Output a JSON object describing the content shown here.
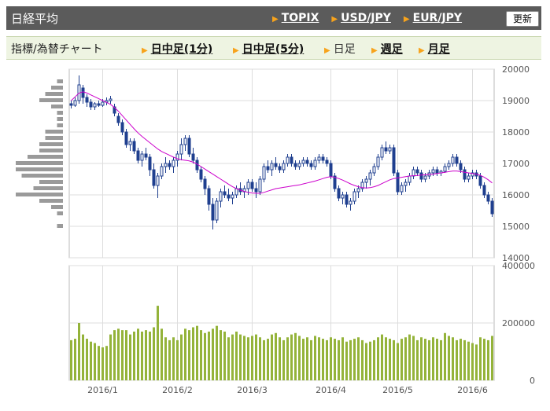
{
  "header": {
    "title": "日経平均",
    "links": [
      "TOPIX",
      "USD/JPY",
      "EUR/JPY"
    ],
    "update_label": "更新"
  },
  "subbar": {
    "label": "指標/為替チャート",
    "tabs": [
      {
        "label": "日中足(1分)",
        "active": false
      },
      {
        "label": "日中足(5分)",
        "active": false
      },
      {
        "label": "日足",
        "active": true
      },
      {
        "label": "週足",
        "active": false
      },
      {
        "label": "月足",
        "active": false
      }
    ]
  },
  "colors": {
    "candle": "#1f3f8f",
    "moving_average": "#cc00cc",
    "volume": "#94b33a",
    "histogram": "#9a9a9a",
    "grid": "#dddddd",
    "header_bg": "#5b5b5b",
    "accent_triangle": "#f7a31c"
  },
  "chart_data": [
    {
      "type": "candlestick",
      "title": "",
      "ylim": [
        14000,
        20000
      ],
      "y_ticks": [
        20000,
        19000,
        18000,
        17000,
        16000,
        15000,
        14000
      ],
      "x_ticks": [
        "2016/1",
        "2016/2",
        "2016/3",
        "2016/4",
        "2016/5",
        "2016/6"
      ],
      "grid": true,
      "series": [
        {
          "kind": "candles",
          "ohlc": [
            [
              18900,
              19000,
              18750,
              18850
            ],
            [
              18850,
              19100,
              18800,
              19000
            ],
            [
              19000,
              19800,
              18900,
              19500
            ],
            [
              19400,
              19500,
              18900,
              19100
            ],
            [
              19100,
              19200,
              18800,
              18950
            ],
            [
              18950,
              19050,
              18700,
              18800
            ],
            [
              18800,
              18950,
              18700,
              18900
            ],
            [
              18900,
              19000,
              18800,
              18850
            ],
            [
              18850,
              19050,
              18800,
              18950
            ],
            [
              18950,
              19100,
              18850,
              19000
            ],
            [
              19000,
              19150,
              18900,
              19050
            ],
            [
              18800,
              18900,
              18500,
              18600
            ],
            [
              18500,
              18600,
              18200,
              18300
            ],
            [
              18300,
              18400,
              17900,
              18000
            ],
            [
              18000,
              18100,
              17500,
              17600
            ],
            [
              17600,
              17800,
              17400,
              17700
            ],
            [
              17700,
              17800,
              17300,
              17400
            ],
            [
              17400,
              17500,
              17000,
              17100
            ],
            [
              17100,
              17400,
              16900,
              17300
            ],
            [
              17300,
              17500,
              17100,
              17200
            ],
            [
              17200,
              17300,
              16600,
              16800
            ],
            [
              16800,
              17000,
              16200,
              16300
            ],
            [
              16300,
              16700,
              15900,
              16600
            ],
            [
              16600,
              17000,
              16500,
              16900
            ],
            [
              16900,
              17200,
              16700,
              17000
            ],
            [
              17000,
              17100,
              16800,
              16900
            ],
            [
              16900,
              17200,
              16700,
              17100
            ],
            [
              17100,
              17400,
              16900,
              17300
            ],
            [
              17300,
              17800,
              17100,
              17600
            ],
            [
              17600,
              17900,
              17400,
              17800
            ],
            [
              17800,
              17900,
              17200,
              17300
            ],
            [
              17300,
              17500,
              17000,
              17100
            ],
            [
              17100,
              17200,
              16700,
              16800
            ],
            [
              16800,
              16900,
              16400,
              16500
            ],
            [
              16500,
              16600,
              16000,
              16200
            ],
            [
              16200,
              16300,
              15500,
              15700
            ],
            [
              15700,
              15900,
              14900,
              15200
            ],
            [
              15200,
              15900,
              15100,
              15800
            ],
            [
              15800,
              16200,
              15600,
              16100
            ],
            [
              16100,
              16300,
              15900,
              16000
            ],
            [
              16000,
              16200,
              15800,
              15900
            ],
            [
              15900,
              16100,
              15700,
              16000
            ],
            [
              16000,
              16300,
              15900,
              16200
            ],
            [
              16200,
              16400,
              16000,
              16100
            ],
            [
              16100,
              16300,
              15900,
              16200
            ],
            [
              16200,
              16500,
              16000,
              16400
            ],
            [
              16400,
              16500,
              16100,
              16200
            ],
            [
              16200,
              16400,
              15900,
              16100
            ],
            [
              16100,
              16600,
              16000,
              16500
            ],
            [
              16500,
              17000,
              16400,
              16900
            ],
            [
              16900,
              17100,
              16700,
              16800
            ],
            [
              16800,
              17100,
              16600,
              17000
            ],
            [
              17000,
              17200,
              16800,
              16900
            ],
            [
              16900,
              17000,
              16700,
              16800
            ],
            [
              16800,
              17100,
              16700,
              17000
            ],
            [
              17000,
              17300,
              16900,
              17200
            ],
            [
              17200,
              17300,
              16900,
              17000
            ],
            [
              17000,
              17100,
              16800,
              16900
            ],
            [
              16900,
              17100,
              16800,
              17000
            ],
            [
              17000,
              17200,
              16900,
              17100
            ],
            [
              17100,
              17200,
              16900,
              17000
            ],
            [
              17000,
              17100,
              16800,
              16900
            ],
            [
              16900,
              17200,
              16800,
              17100
            ],
            [
              17100,
              17300,
              17000,
              17200
            ],
            [
              17200,
              17300,
              17000,
              17100
            ],
            [
              17100,
              17200,
              16900,
              17000
            ],
            [
              17000,
              17100,
              16500,
              16600
            ],
            [
              16600,
              16700,
              16100,
              16200
            ],
            [
              16200,
              16300,
              15800,
              15900
            ],
            [
              15900,
              16100,
              15700,
              16000
            ],
            [
              16000,
              16100,
              15600,
              15700
            ],
            [
              15700,
              15900,
              15500,
              15800
            ],
            [
              15800,
              16200,
              15700,
              16100
            ],
            [
              16100,
              16300,
              15900,
              16200
            ],
            [
              16200,
              16500,
              16100,
              16400
            ],
            [
              16400,
              16600,
              16200,
              16500
            ],
            [
              16500,
              16800,
              16300,
              16700
            ],
            [
              16700,
              17000,
              16600,
              16900
            ],
            [
              16900,
              17300,
              16800,
              17200
            ],
            [
              17200,
              17600,
              17100,
              17500
            ],
            [
              17500,
              17700,
              17300,
              17400
            ],
            [
              17400,
              17600,
              17300,
              17500
            ],
            [
              17500,
              17600,
              16600,
              16700
            ],
            [
              16700,
              16800,
              16000,
              16100
            ],
            [
              16100,
              16400,
              16000,
              16300
            ],
            [
              16300,
              16500,
              16100,
              16400
            ],
            [
              16400,
              16700,
              16300,
              16600
            ],
            [
              16600,
              16900,
              16500,
              16800
            ],
            [
              16800,
              16900,
              16600,
              16700
            ],
            [
              16700,
              16800,
              16400,
              16500
            ],
            [
              16500,
              16700,
              16400,
              16600
            ],
            [
              16600,
              16800,
              16500,
              16700
            ],
            [
              16700,
              16900,
              16600,
              16800
            ],
            [
              16800,
              16900,
              16600,
              16700
            ],
            [
              16700,
              16800,
              16600,
              16750
            ],
            [
              16750,
              17000,
              16700,
              16900
            ],
            [
              16900,
              17100,
              16800,
              17000
            ],
            [
              17000,
              17300,
              16900,
              17200
            ],
            [
              17200,
              17300,
              16900,
              17000
            ],
            [
              17000,
              17100,
              16700,
              16800
            ],
            [
              16800,
              16900,
              16400,
              16500
            ],
            [
              16500,
              16700,
              16400,
              16600
            ],
            [
              16600,
              16800,
              16500,
              16700
            ],
            [
              16700,
              16800,
              16500,
              16600
            ],
            [
              16600,
              16700,
              16200,
              16300
            ],
            [
              16300,
              16400,
              15900,
              16000
            ],
            [
              16000,
              16100,
              15700,
              15800
            ],
            [
              15800,
              15900,
              15300,
              15400
            ]
          ]
        },
        {
          "kind": "moving_average",
          "values": [
            19000,
            19120,
            19240,
            19280,
            19240,
            19180,
            19120,
            19060,
            19000,
            18940,
            18880,
            18780,
            18660,
            18520,
            18380,
            18240,
            18100,
            17970,
            17860,
            17760,
            17660,
            17560,
            17460,
            17380,
            17320,
            17260,
            17200,
            17150,
            17120,
            17100,
            17080,
            17040,
            16980,
            16900,
            16820,
            16740,
            16660,
            16580,
            16500,
            16420,
            16340,
            16260,
            16200,
            16150,
            16110,
            16080,
            16060,
            16050,
            16050,
            16080,
            16120,
            16160,
            16200,
            16220,
            16240,
            16260,
            16280,
            16300,
            16320,
            16350,
            16380,
            16410,
            16440,
            16480,
            16520,
            16560,
            16580,
            16560,
            16520,
            16470,
            16410,
            16350,
            16300,
            16260,
            16230,
            16220,
            16230,
            16260,
            16300,
            16360,
            16420,
            16480,
            16520,
            16540,
            16560,
            16580,
            16600,
            16610,
            16620,
            16630,
            16640,
            16650,
            16660,
            16680,
            16700,
            16720,
            16740,
            16760,
            16760,
            16740,
            16720,
            16700,
            16680,
            16660,
            16620,
            16560,
            16480,
            16380
          ]
        },
        {
          "kind": "price_histogram",
          "bins": [
            19600,
            19400,
            19200,
            19000,
            18800,
            18600,
            18400,
            18200,
            18000,
            17800,
            17600,
            17400,
            17200,
            17000,
            16800,
            16600,
            16400,
            16200,
            16000,
            15800,
            15600,
            15400,
            15000
          ],
          "counts": [
            1,
            2,
            3,
            4,
            2,
            1,
            1,
            1,
            3,
            3,
            4,
            4,
            6,
            8,
            8,
            7,
            4,
            5,
            8,
            4,
            2,
            1,
            1
          ]
        }
      ]
    },
    {
      "type": "bar",
      "title": "",
      "ylim": [
        0,
        400000
      ],
      "y_ticks": [
        400000,
        200000,
        0
      ],
      "values": [
        140000,
        145000,
        200000,
        160000,
        145000,
        135000,
        130000,
        120000,
        115000,
        120000,
        160000,
        175000,
        180000,
        175000,
        175000,
        160000,
        170000,
        180000,
        170000,
        175000,
        170000,
        185000,
        260000,
        180000,
        150000,
        140000,
        150000,
        140000,
        160000,
        180000,
        175000,
        185000,
        190000,
        175000,
        165000,
        170000,
        180000,
        190000,
        175000,
        170000,
        150000,
        160000,
        170000,
        160000,
        155000,
        150000,
        155000,
        160000,
        150000,
        140000,
        145000,
        160000,
        165000,
        150000,
        140000,
        150000,
        160000,
        165000,
        155000,
        145000,
        150000,
        140000,
        155000,
        150000,
        145000,
        140000,
        150000,
        145000,
        140000,
        150000,
        135000,
        140000,
        145000,
        150000,
        140000,
        130000,
        135000,
        140000,
        150000,
        160000,
        150000,
        145000,
        140000,
        130000,
        145000,
        150000,
        160000,
        155000,
        140000,
        150000,
        145000,
        140000,
        150000,
        145000,
        140000,
        165000,
        155000,
        150000,
        140000,
        145000,
        140000,
        135000,
        130000,
        125000,
        150000,
        145000,
        140000,
        155000
      ],
      "xlabel": "",
      "ylabel": ""
    }
  ]
}
